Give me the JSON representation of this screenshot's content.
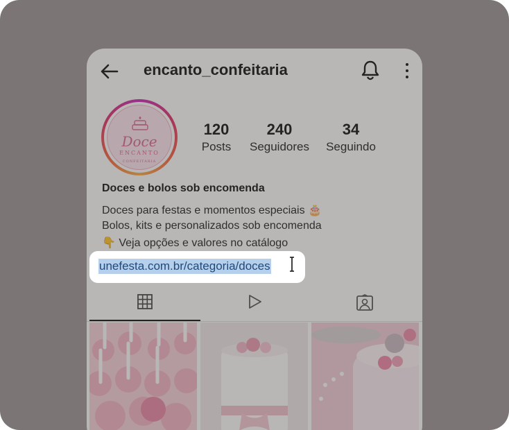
{
  "header": {
    "username": "encanto_confeitaria",
    "back_icon": "arrow-left-icon",
    "bell_icon": "bell-icon",
    "more_icon": "more-vertical-icon"
  },
  "profile": {
    "avatar_logo": {
      "line1": "Doce",
      "line2": "ENCANTO",
      "line3": "CONFEITARIA"
    },
    "stats": [
      {
        "value": "120",
        "label": "Posts"
      },
      {
        "value": "240",
        "label": "Seguidores"
      },
      {
        "value": "34",
        "label": "Seguindo"
      }
    ],
    "bio": {
      "title": "Doces e bolos sob encomenda",
      "lines": [
        "Doces para festas e momentos especiais 🎂",
        "Bolos, kits e personalizados sob encomenda",
        "👇 Veja opções e valores no catálogo"
      ],
      "link": "unefesta.com.br/categoria/doces"
    }
  },
  "tabs": [
    {
      "icon": "grid-icon",
      "active": true
    },
    {
      "icon": "reels-play-icon",
      "active": false
    },
    {
      "icon": "tagged-person-icon",
      "active": false
    }
  ],
  "posts": [
    {
      "subject": "pink cake pops"
    },
    {
      "subject": "white cake with pink roses"
    },
    {
      "subject": "pink cake with macarons"
    }
  ]
}
